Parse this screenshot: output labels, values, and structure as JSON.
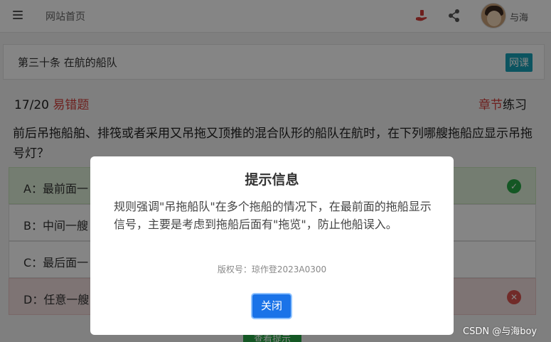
{
  "header": {
    "home_label": "网站首页",
    "username": "与海"
  },
  "chapter": {
    "title": "第三十条 在航的船队",
    "badge": "网课"
  },
  "question": {
    "progress": "17/20",
    "tag": "易错题",
    "practice_red": "章节",
    "practice_rest": "练习",
    "text": "前后吊拖船舶、排筏或者采用又吊拖又顶推的混合队形的船队在航时，在下列哪艘拖船应显示吊拖号灯？"
  },
  "options": [
    {
      "label": "A：最前面一",
      "status": "correct"
    },
    {
      "label": "B：中间一艘",
      "status": "none"
    },
    {
      "label": "C：最后面一",
      "status": "none"
    },
    {
      "label": "D：任意一艘",
      "status": "wrong"
    }
  ],
  "hint_button": "查看提示",
  "modal": {
    "title": "提示信息",
    "body": "规则强调\"吊拖船队\"在多个拖船的情况下，在最前面的拖船显示信号，主要是考虑到拖船后面有\"拖览\"，防止他船误入。",
    "copyright": "版权号：琼作登2023A0300",
    "close_label": "关闭"
  },
  "watermark": "CSDN @与海boy",
  "colors": {
    "accent_red": "#d43f3a",
    "correct_bg": "#dff0d8",
    "wrong_bg": "#f2dede",
    "badge": "#17a2b8",
    "close_button": "#1a73e8"
  }
}
